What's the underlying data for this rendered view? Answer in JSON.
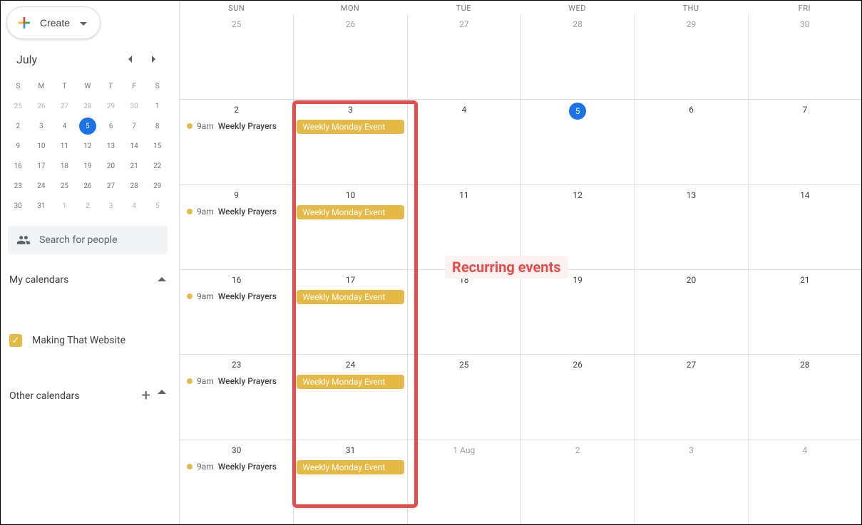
{
  "create": {
    "label": "Create"
  },
  "mini": {
    "month_label": "July",
    "dow": [
      "S",
      "M",
      "T",
      "W",
      "T",
      "F",
      "S"
    ],
    "rows": [
      [
        {
          "n": "25",
          "dim": true
        },
        {
          "n": "26",
          "dim": true
        },
        {
          "n": "27",
          "dim": true
        },
        {
          "n": "28",
          "dim": true
        },
        {
          "n": "29",
          "dim": true
        },
        {
          "n": "30",
          "dim": true
        },
        {
          "n": "1"
        }
      ],
      [
        {
          "n": "2"
        },
        {
          "n": "3"
        },
        {
          "n": "4"
        },
        {
          "n": "5",
          "today": true
        },
        {
          "n": "6"
        },
        {
          "n": "7"
        },
        {
          "n": "8"
        }
      ],
      [
        {
          "n": "9"
        },
        {
          "n": "10"
        },
        {
          "n": "11"
        },
        {
          "n": "12"
        },
        {
          "n": "13"
        },
        {
          "n": "14"
        },
        {
          "n": "15"
        }
      ],
      [
        {
          "n": "16"
        },
        {
          "n": "17"
        },
        {
          "n": "18"
        },
        {
          "n": "19"
        },
        {
          "n": "20"
        },
        {
          "n": "21"
        },
        {
          "n": "22"
        }
      ],
      [
        {
          "n": "23"
        },
        {
          "n": "24"
        },
        {
          "n": "25"
        },
        {
          "n": "26"
        },
        {
          "n": "27"
        },
        {
          "n": "28"
        },
        {
          "n": "29"
        }
      ],
      [
        {
          "n": "30"
        },
        {
          "n": "31"
        },
        {
          "n": "1",
          "dim": true
        },
        {
          "n": "2",
          "dim": true
        },
        {
          "n": "3",
          "dim": true
        },
        {
          "n": "4",
          "dim": true
        },
        {
          "n": "5",
          "dim": true
        }
      ]
    ]
  },
  "search": {
    "placeholder": "Search for people"
  },
  "sections": {
    "my_calendars": "My calendars",
    "other_calendars": "Other calendars"
  },
  "cal_item": {
    "name": "Making That Website"
  },
  "weekdays": [
    "SUN",
    "MON",
    "TUE",
    "WED",
    "THU",
    "FRI"
  ],
  "events": {
    "prayers_time": "9am",
    "prayers_title": "Weekly Prayers",
    "monday_title": "Weekly Monday Event"
  },
  "big_grid": [
    [
      {
        "n": "25",
        "dim": true
      },
      {
        "n": "26",
        "dim": true
      },
      {
        "n": "27",
        "dim": true
      },
      {
        "n": "28",
        "dim": true
      },
      {
        "n": "29",
        "dim": true
      },
      {
        "n": "30",
        "dim": true
      }
    ],
    [
      {
        "n": "2",
        "prayers": true
      },
      {
        "n": "3",
        "monday": true
      },
      {
        "n": "4"
      },
      {
        "n": "5",
        "today": true
      },
      {
        "n": "6"
      },
      {
        "n": "7"
      }
    ],
    [
      {
        "n": "9",
        "prayers": true
      },
      {
        "n": "10",
        "monday": true
      },
      {
        "n": "11"
      },
      {
        "n": "12"
      },
      {
        "n": "13"
      },
      {
        "n": "14"
      }
    ],
    [
      {
        "n": "16",
        "prayers": true
      },
      {
        "n": "17",
        "monday": true
      },
      {
        "n": "18"
      },
      {
        "n": "19"
      },
      {
        "n": "20"
      },
      {
        "n": "21"
      }
    ],
    [
      {
        "n": "23",
        "prayers": true
      },
      {
        "n": "24",
        "monday": true
      },
      {
        "n": "25"
      },
      {
        "n": "26"
      },
      {
        "n": "27"
      },
      {
        "n": "28"
      }
    ],
    [
      {
        "n": "30",
        "prayers": true
      },
      {
        "n": "31",
        "monday": true
      },
      {
        "n": "1 Aug",
        "dim": true
      },
      {
        "n": "2",
        "dim": true
      },
      {
        "n": "3",
        "dim": true
      },
      {
        "n": "4",
        "dim": true
      }
    ]
  ],
  "annotation": {
    "text": "Recurring events"
  },
  "colors": {
    "accent": "#e5b945",
    "primary": "#1a73e8",
    "highlight": "#e94b4b"
  }
}
